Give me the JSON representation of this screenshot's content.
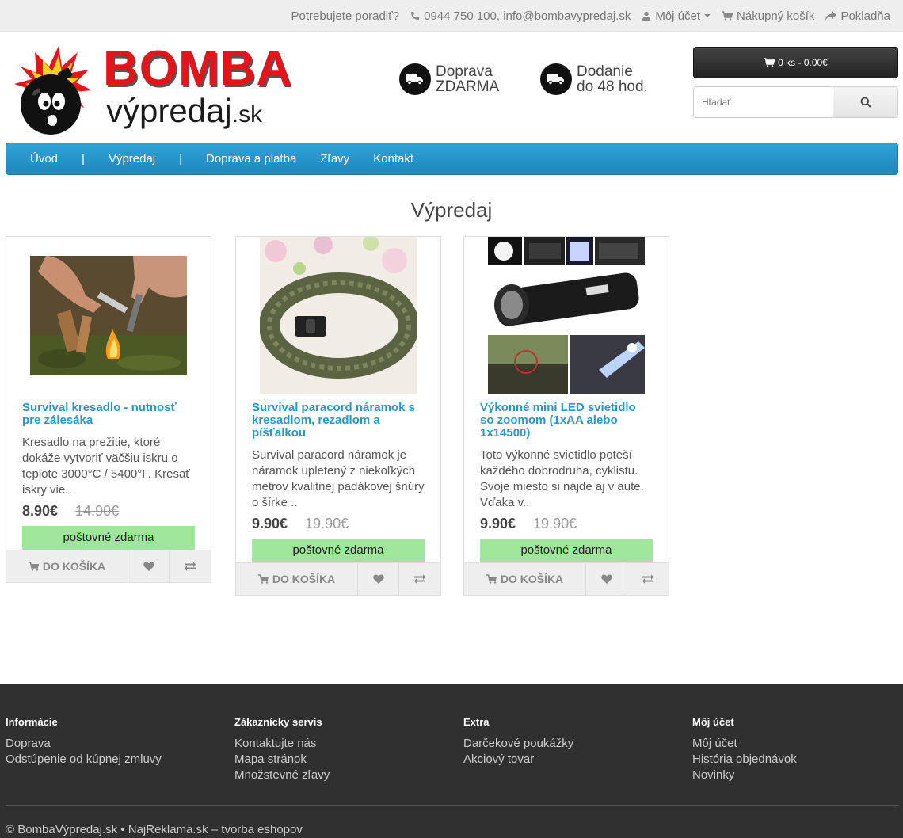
{
  "topbar": {
    "help_text": "Potrebujete poradiť?",
    "contact": "0944 750 100, info@bombavypredaj.sk",
    "account": "Môj účet",
    "cart": "Nákupný košík",
    "checkout": "Pokladňa"
  },
  "logo": {
    "brand": "BOMBA",
    "sub": "výpredaj",
    "tld": ".sk"
  },
  "features": [
    {
      "line1": "Doprava",
      "line2": "ZDARMA"
    },
    {
      "line1": "Dodanie",
      "line2": "do 48 hod."
    }
  ],
  "header_cart": "0 ks - 0.00€",
  "search": {
    "placeholder": "Hľadať"
  },
  "nav": {
    "items": [
      "Úvod",
      "Výpredaj",
      "Doprava a platba",
      "Zľavy",
      "Kontakt"
    ],
    "separator": "|"
  },
  "page_title": "Výpredaj",
  "products": [
    {
      "name": "Survival kresadlo - nutnosť pre zálesáka",
      "desc": "Kresadlo na prežitie, ktoré dokáže vytvoriť väčšiu iskru o teplote 3000°C / 5400°F. Kresať iskry vie..",
      "price": "8.90€",
      "old_price": "14.90€",
      "shipping": "poštovné zdarma",
      "cart_label": "DO KOŠÍKA"
    },
    {
      "name": "Survival paracord náramok s kresadlom, rezadlom a píšťalkou",
      "desc": "Survival paracord náramok je náramok upletený z niekoľkých metrov kvalitnej padákovej šnúry o šírke ..",
      "price": "9.90€",
      "old_price": "19.90€",
      "shipping": "poštovné zdarma",
      "cart_label": "DO KOŠÍKA"
    },
    {
      "name": "Výkonné mini LED svietidlo so zoomom (1xAA alebo 1x14500)",
      "desc": "Toto výkonné svietidlo poteší každého dobrodruha, cyklistu. Svoje miesto si nájde aj v aute. Vďaka v..",
      "price": "9.90€",
      "old_price": "19.90€",
      "shipping": "poštovné zdarma",
      "cart_label": "DO KOŠÍKA"
    }
  ],
  "footer": {
    "columns": [
      {
        "title": "Informácie",
        "links": [
          "Doprava",
          "Odstúpenie od kúpnej zmluvy"
        ]
      },
      {
        "title": "Zákaznícky servis",
        "links": [
          "Kontaktujte nás",
          "Mapa stránok",
          "Množstevné zľavy"
        ]
      },
      {
        "title": "Extra",
        "links": [
          "Darčekové poukážky",
          "Akciový tovar"
        ]
      },
      {
        "title": "Môj účet",
        "links": [
          "Môj účet",
          "História objednávok",
          "Novinky"
        ]
      }
    ],
    "copyright": "© BombaVýpredaj.sk",
    "bullet": "•",
    "credit": "NajReklama.sk – tvorba eshopov"
  },
  "colors": {
    "accent": "#2a95c6",
    "nav": "#2196c9",
    "brand_red": "#e4141b",
    "shipping_bg": "#9fe69a",
    "footer_bg": "#303030"
  }
}
